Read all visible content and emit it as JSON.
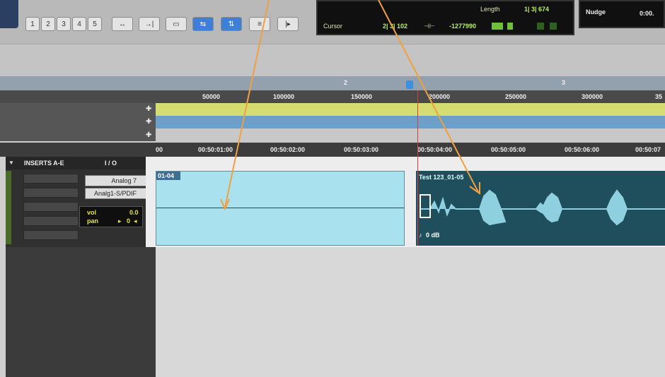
{
  "toolbar": {
    "zoom_presets": [
      "1",
      "2",
      "3",
      "4",
      "5"
    ],
    "counter": {
      "length_label": "Length",
      "length_value": "1| 3| 674",
      "cursor_label": "Cursor",
      "cursor_value": "2| 3| 102",
      "cursor_samples": "-1277990"
    },
    "nudge": {
      "label": "Nudge",
      "value": "0:00."
    }
  },
  "rulers": {
    "bars": [
      "2",
      "3"
    ],
    "samples": [
      "50000",
      "100000",
      "150000",
      "200000",
      "250000",
      "300000",
      "35"
    ],
    "timecode": [
      "00",
      "00:50:01:00",
      "00:50:02:00",
      "00:50:03:00",
      "00:50:04:00",
      "00:50:05:00",
      "00:50:06:00",
      "00:50:07"
    ]
  },
  "track": {
    "inserts_header": "INSERTS A-E",
    "io_header": "I / O",
    "input": "Analog 7",
    "output": "Analg1-S/PDIF",
    "vol_label": "vol",
    "vol_value": "0.0",
    "pan_label": "pan",
    "pan_value": "0"
  },
  "clips": [
    {
      "name": "01-04"
    },
    {
      "name": "Test 123_01-05",
      "gain": "0 dB"
    }
  ],
  "colors": {
    "clip1": "#a9e2ee",
    "clip2": "#1f4e5c",
    "waveform": "#8fd0e0",
    "lane_yellow": "#d4dc72",
    "lane_blue": "#6e9fc8",
    "arrow": "#f0a040"
  }
}
